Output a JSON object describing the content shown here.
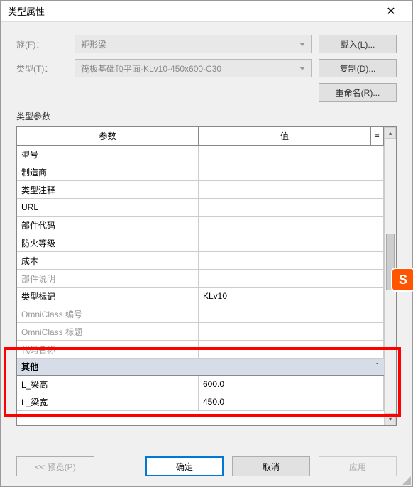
{
  "window": {
    "title": "类型属性",
    "close": "✕"
  },
  "form": {
    "family_label": "族(F)：",
    "family_value": "矩形梁",
    "type_label": "类型(T)：",
    "type_value": "筏板基础顶平面-KLv10-450x600-C30"
  },
  "buttons": {
    "load": "载入(L)...",
    "duplicate": "复制(D)...",
    "rename": "重命名(R)..."
  },
  "section_label": "类型参数",
  "table": {
    "header_param": "参数",
    "header_value": "值",
    "header_eq": "=",
    "rows": [
      {
        "param": "型号",
        "value": ""
      },
      {
        "param": "制造商",
        "value": ""
      },
      {
        "param": "类型注释",
        "value": ""
      },
      {
        "param": "URL",
        "value": ""
      },
      {
        "param": "部件代码",
        "value": ""
      },
      {
        "param": "防火等级",
        "value": ""
      },
      {
        "param": "成本",
        "value": ""
      },
      {
        "param": "部件说明",
        "value": "",
        "gray": true
      },
      {
        "param": "类型标记",
        "value": "KLv10"
      },
      {
        "param": "OmniClass 编号",
        "value": "",
        "gray": true
      },
      {
        "param": "OmniClass 标题",
        "value": "",
        "gray": true
      },
      {
        "param": "代码名称",
        "value": "",
        "gray": true
      }
    ],
    "group": {
      "label": "其他",
      "chevron": "ˇ"
    },
    "rows2": [
      {
        "param": "L_梁高",
        "value": "600.0"
      },
      {
        "param": "L_梁宽",
        "value": "450.0"
      }
    ]
  },
  "footer": {
    "preview": "<< 预览(P)",
    "ok": "确定",
    "cancel": "取消",
    "apply": "应用"
  },
  "ime": "S"
}
